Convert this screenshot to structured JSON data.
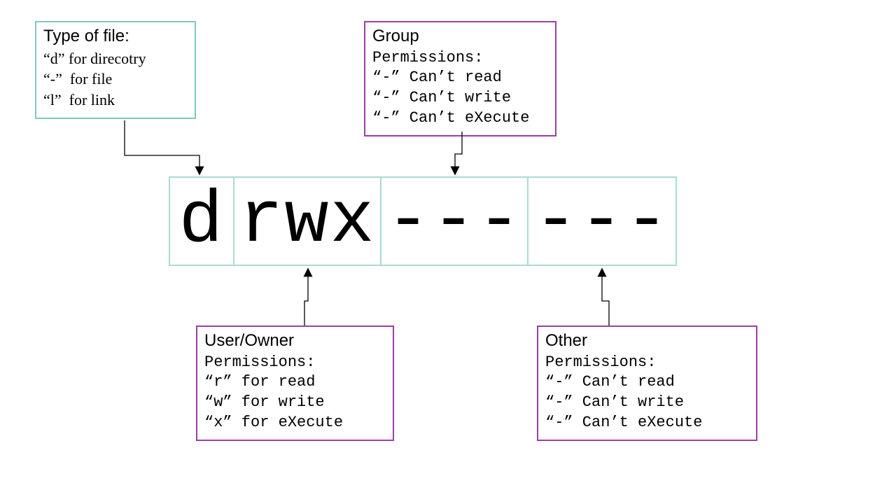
{
  "perm": {
    "type": "d",
    "user": "rwx",
    "group": "---",
    "other": "---"
  },
  "type_box": {
    "title": "Type of file:",
    "l1": "“d” for direcotry",
    "l2": "“-”  for file",
    "l3": "“l”  for link"
  },
  "group_box": {
    "title": "Group",
    "sub": "Permissions:",
    "l1": "“-” Can’t read",
    "l2": "“-” Can’t write",
    "l3": "“-” Can’t eXecute"
  },
  "user_box": {
    "title": "User/Owner",
    "sub": "Permissions:",
    "l1": "“r” for read",
    "l2": "“w” for write",
    "l3": "“x” for eXecute"
  },
  "other_box": {
    "title": "Other",
    "sub": "Permissions:",
    "l1": "“-” Can’t read",
    "l2": "“-” Can’t write",
    "l3": "“-” Can’t eXecute"
  },
  "colors": {
    "teal": "#7fc9c0",
    "purple": "#9b3fa8"
  }
}
